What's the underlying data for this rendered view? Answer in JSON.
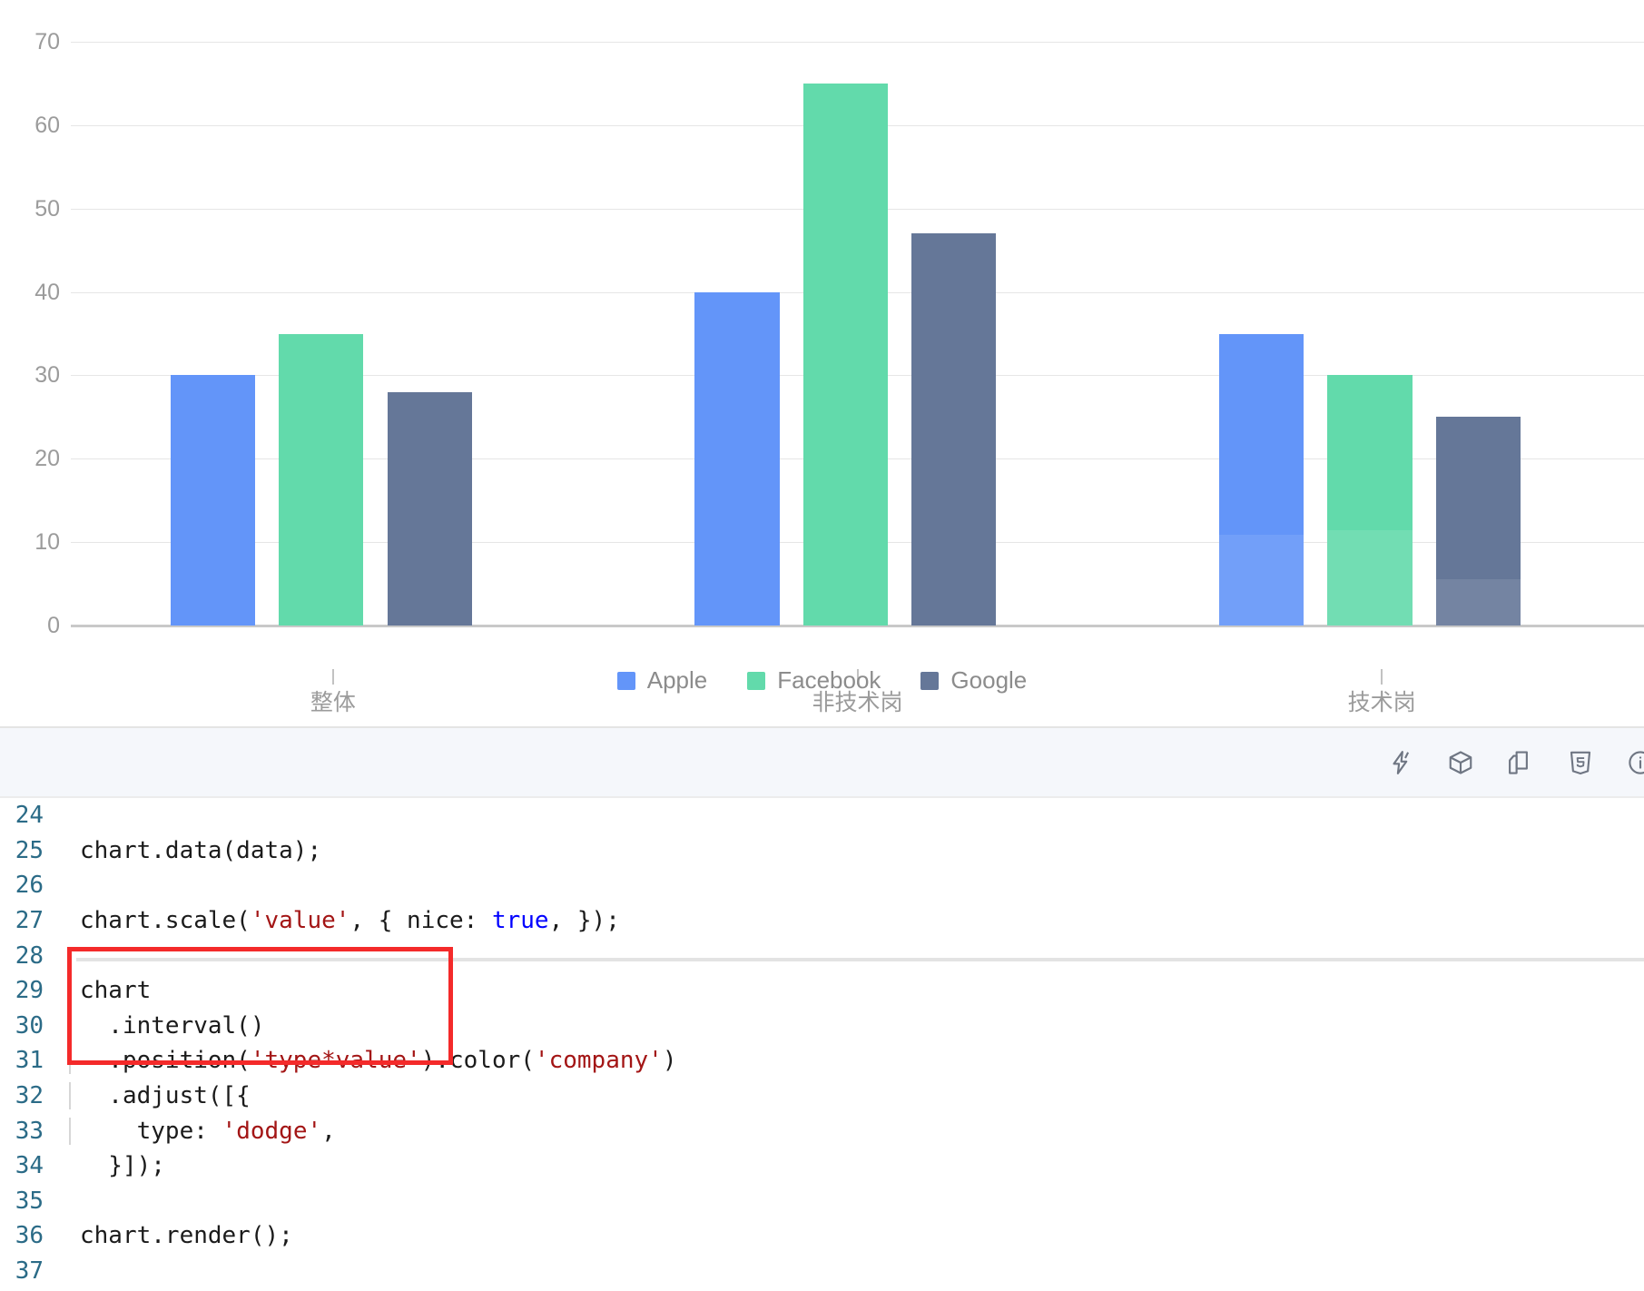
{
  "chart_data": {
    "type": "bar",
    "title": "",
    "subtitle": "",
    "xlabel": "",
    "ylabel": "",
    "grid": true,
    "legend_position": "bottom",
    "categories": [
      "整体",
      "非技术岗",
      "技术岗"
    ],
    "ylim": [
      0,
      70
    ],
    "yticks": [
      0,
      10,
      20,
      30,
      40,
      50,
      60,
      70
    ],
    "ytick_labels": [
      "0",
      "10",
      "20",
      "30",
      "40",
      "50",
      "60",
      "70"
    ],
    "series": [
      {
        "name": "Apple",
        "color": "#6395f9",
        "values": [
          30,
          40,
          35
        ]
      },
      {
        "name": "Facebook",
        "color": "#62daab",
        "values": [
          35,
          65,
          30
        ]
      },
      {
        "name": "Google",
        "color": "#657798",
        "values": [
          28,
          47,
          25
        ]
      }
    ]
  },
  "legend": {
    "items": [
      {
        "label": "Apple",
        "color": "#6395f9"
      },
      {
        "label": "Facebook",
        "color": "#62daab"
      },
      {
        "label": "Google",
        "color": "#657798"
      }
    ]
  },
  "editor": {
    "toolbar": {
      "icons": [
        {
          "name": "lightning-bolt-icon",
          "title": "StackBlitz"
        },
        {
          "name": "codesandbox-cube-icon",
          "title": "CodeSandbox"
        },
        {
          "name": "copy-file-icon",
          "title": "Copy"
        },
        {
          "name": "html5-shield-icon",
          "title": "HTML"
        },
        {
          "name": "info-circle-icon",
          "title": "Info"
        }
      ]
    },
    "active_line": 28,
    "lines": [
      {
        "no": "24",
        "text": "",
        "guide": false
      },
      {
        "no": "25",
        "text": "chart.data(data);",
        "guide": false
      },
      {
        "no": "26",
        "text": "",
        "guide": false
      },
      {
        "no": "27",
        "text": "chart.scale('value', { nice: true, });",
        "guide": false
      },
      {
        "no": "28",
        "text": "",
        "guide": false
      },
      {
        "no": "29",
        "text": "chart",
        "guide": false
      },
      {
        "no": "30",
        "text": "  .interval()",
        "guide": true
      },
      {
        "no": "31",
        "text": "  .position('type*value').color('company')",
        "guide": true
      },
      {
        "no": "32",
        "text": "  .adjust([{",
        "guide": true
      },
      {
        "no": "33",
        "text": "    type: 'dodge',",
        "guide": true
      },
      {
        "no": "34",
        "text": "  }]);",
        "guide": false
      },
      {
        "no": "35",
        "text": "",
        "guide": false
      },
      {
        "no": "36",
        "text": "chart.render();",
        "guide": false
      },
      {
        "no": "37",
        "text": "",
        "guide": false
      }
    ],
    "highlight_box": {
      "name": "adjust-dodge-highlight",
      "color": "#f42a2a",
      "from_line": "32",
      "to_line": "35"
    }
  }
}
